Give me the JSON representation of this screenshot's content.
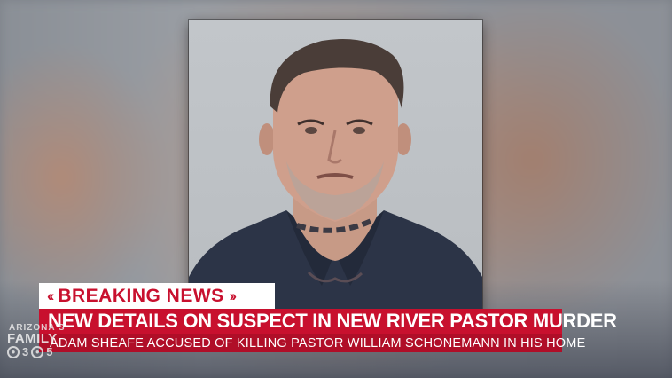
{
  "lower_third": {
    "breaking_label": "BREAKING NEWS",
    "chevron_left": "‹‹",
    "chevron_right": "››",
    "headline": "NEW DETAILS ON SUSPECT IN NEW RIVER PASTOR MURDER",
    "subheadline": "ADAM SHEAFE ACCUSED OF KILLING PASTOR WILLIAM SCHONEMANN IN HIS HOME"
  },
  "station_watermark": {
    "line1": "ARIZONA'S",
    "line2": "FAMILY",
    "channel_a": "3",
    "channel_b": "5"
  },
  "colors": {
    "breaking_red": "#c8102e",
    "headline_bar": "#c8102e",
    "sub_bar": "#b00e28",
    "breaking_bg": "#ffffff"
  }
}
